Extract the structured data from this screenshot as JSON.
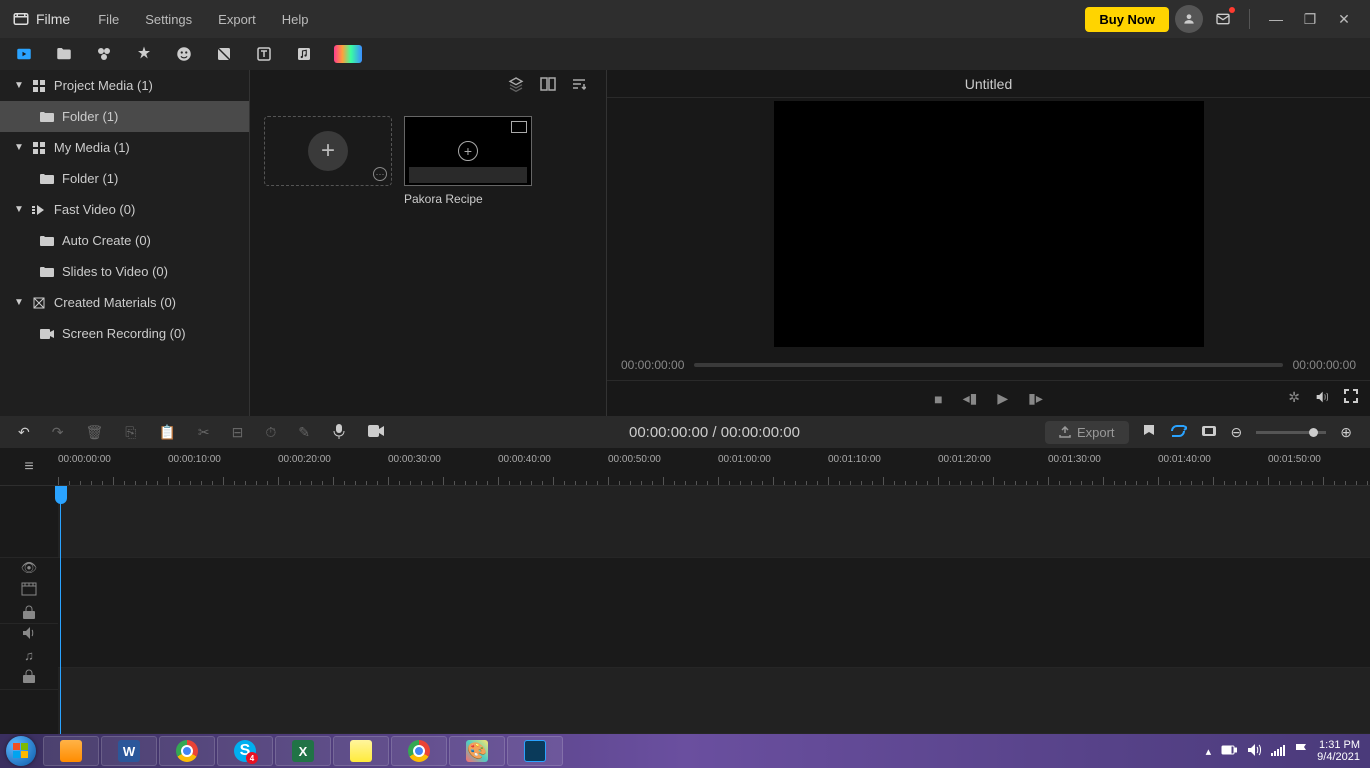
{
  "app": {
    "name": "Filme",
    "buy_now": "Buy Now"
  },
  "menu": {
    "file": "File",
    "settings": "Settings",
    "export": "Export",
    "help": "Help"
  },
  "sidebar": {
    "project_media": "Project Media (1)",
    "folder": "Folder (1)",
    "my_media": "My Media (1)",
    "my_folder": "Folder (1)",
    "fast_video": "Fast Video (0)",
    "auto_create": "Auto Create (0)",
    "slides_to_video": "Slides to Video (0)",
    "created_materials": "Created Materials (0)",
    "screen_recording": "Screen Recording (0)"
  },
  "clip": {
    "name": "Pakora Recipe"
  },
  "preview": {
    "title": "Untitled",
    "time_left": "00:00:00:00",
    "time_right": "00:00:00:00"
  },
  "editbar": {
    "timecode": "00:00:00:00 / 00:00:00:00",
    "export": "Export"
  },
  "ruler": {
    "labels": [
      "00:00:00:00",
      "00:00:10:00",
      "00:00:20:00",
      "00:00:30:00",
      "00:00:40:00",
      "00:00:50:00",
      "00:01:00:00",
      "00:01:10:00",
      "00:01:20:00",
      "00:01:30:00",
      "00:01:40:00",
      "00:01:50:00"
    ]
  },
  "taskbar": {
    "time": "1:31 PM",
    "date": "9/4/2021"
  }
}
